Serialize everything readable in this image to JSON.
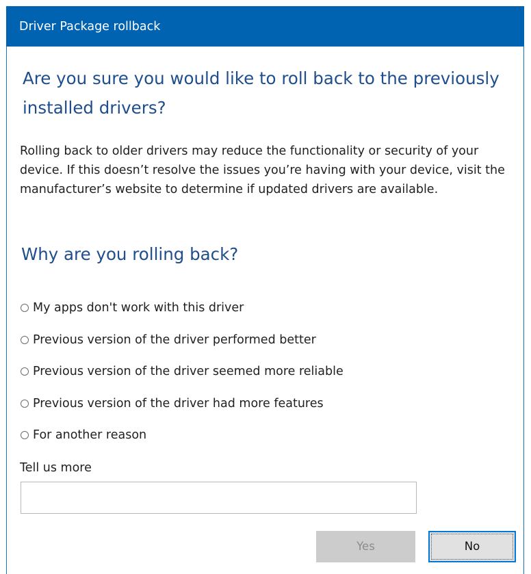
{
  "window": {
    "title": "Driver Package rollback",
    "accent_color": "#0063b1"
  },
  "content": {
    "heading": "Are you sure you would like to roll back to the previously installed drivers?",
    "description": "Rolling back to older drivers may reduce the functionality or security of your device.  If this doesn’t resolve the issues you’re having with your device, visit the manufacturer’s website to determine if updated drivers are available.",
    "reason_heading": "Why are you rolling back?",
    "reasons": [
      {
        "label": "My apps don't work with this driver",
        "selected": false
      },
      {
        "label": "Previous version of the driver performed better",
        "selected": false
      },
      {
        "label": "Previous version of the driver seemed more reliable",
        "selected": false
      },
      {
        "label": "Previous version of the driver had more features",
        "selected": false
      },
      {
        "label": "For another reason",
        "selected": false
      }
    ],
    "tell_us_more_label": "Tell us more",
    "tell_us_more_value": ""
  },
  "buttons": {
    "yes_label": "Yes",
    "yes_enabled": false,
    "no_label": "No",
    "no_focused": true
  }
}
